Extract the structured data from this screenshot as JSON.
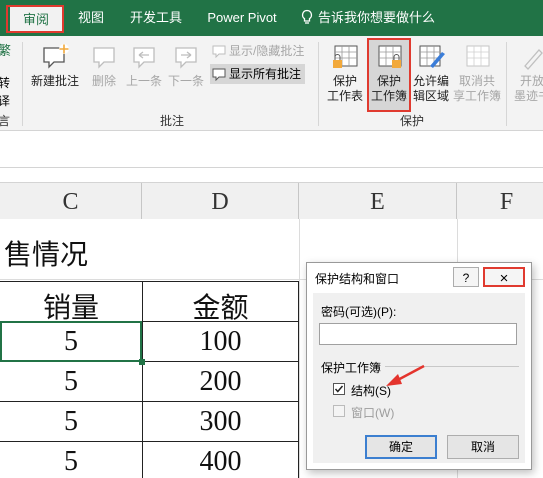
{
  "tabs": {
    "review": "审阅",
    "view": "视图",
    "developer": "开发工具",
    "power_pivot": "Power Pivot",
    "tell_me": "告诉我你想要做什么"
  },
  "ribbon": {
    "left_partial": {
      "top": "繁",
      "mid": "转",
      "bottom": "言"
    },
    "comments": {
      "new": "新建批注",
      "delete": "删除",
      "prev": "上一条",
      "next": "下一条",
      "show_hide": "显示/隐藏批注",
      "show_all": "显示所有批注",
      "group_label": "批注"
    },
    "protect": {
      "sheet_line1": "保护",
      "sheet_line2": "工作表",
      "workbook_line1": "保护",
      "workbook_line2": "工作簿",
      "allow_line1": "允许编",
      "allow_line2": "辑区域",
      "unshare_line1": "取消共",
      "unshare_line2": "享工作簿",
      "group_label": "保护"
    },
    "right_partial": {
      "line1": "开放",
      "line2": "墨迹书"
    }
  },
  "sheet": {
    "columns": [
      "C",
      "D",
      "E",
      "F"
    ],
    "title": "售情况",
    "headers": {
      "c": "销量",
      "d": "金额"
    },
    "rows": [
      {
        "c": "5",
        "d": "100"
      },
      {
        "c": "5",
        "d": "200"
      },
      {
        "c": "5",
        "d": "300"
      },
      {
        "c": "5",
        "d": "400"
      }
    ]
  },
  "dialog": {
    "title": "保护结构和窗口",
    "help": "?",
    "close": "×",
    "password_label": "密码(可选)(P):",
    "password_value": "",
    "section_label": "保护工作簿",
    "structure_label": "结构(S)",
    "structure_checked": true,
    "windows_label": "窗口(W)",
    "windows_checked": false,
    "ok": "确定",
    "cancel": "取消"
  },
  "colors": {
    "ribbon_green": "#217346",
    "highlight_red": "#e03a2f",
    "arrow_red": "#e4342d"
  }
}
